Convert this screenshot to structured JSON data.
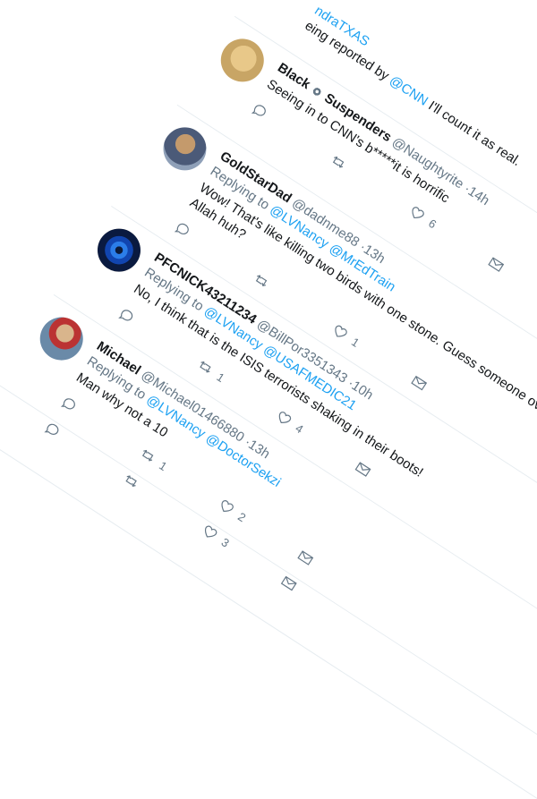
{
  "top_fragment": {
    "handle_partial": "ndraTXAS",
    "text_prefix": "eing reported by ",
    "mention": "@CNN",
    "text_suffix": " I'll count it as real."
  },
  "tweets": [
    {
      "name": "Black",
      "name2": "Suspenders",
      "handle": "@Naughtyrite",
      "time": "·14h",
      "text": "Seeing in to CNN's b*****it is horrific",
      "replies": "",
      "retweets": "",
      "likes": "6"
    },
    {
      "name": "GoldStarDad",
      "handle": "@dadnme88",
      "time": "·13h",
      "replying_label": "Replying to",
      "mentions": [
        "@LVNancy",
        "@MrEdTrain"
      ],
      "text": "Wow! That's like killing two birds with one stone. Guess someone over there must have pissed off Allah huh?",
      "replies": "",
      "retweets": "",
      "likes": "1"
    },
    {
      "name": "PFCNICK43211234",
      "handle": "@BillPor3351343",
      "time": "·10h",
      "replying_label": "Replying to",
      "mentions": [
        "@LVNancy",
        "@USAFMEDIC21"
      ],
      "text": "No, I think that is the ISIS terrorists shaking in their boots!",
      "replies": "",
      "retweets": "1",
      "likes": "4"
    },
    {
      "name": "Michael",
      "handle": "@Michael01466880",
      "time": "·13h",
      "replying_label": "Replying to",
      "mentions": [
        "@LVNancy",
        "@DoctorSekzi"
      ],
      "text": "Man why not a 10",
      "replies": "",
      "retweets": "1",
      "likes": "2"
    },
    {
      "name": "",
      "handle": "",
      "time": "",
      "text": "",
      "replies": "",
      "retweets": "",
      "likes": "3"
    }
  ],
  "icons": {
    "reply": "reply-icon",
    "retweet": "retweet-icon",
    "like": "heart-icon",
    "dm": "envelope-icon",
    "more": "chevron-down-icon"
  },
  "colors": {
    "accent": "#1da1f2",
    "muted": "#657786",
    "text": "#14171a"
  }
}
